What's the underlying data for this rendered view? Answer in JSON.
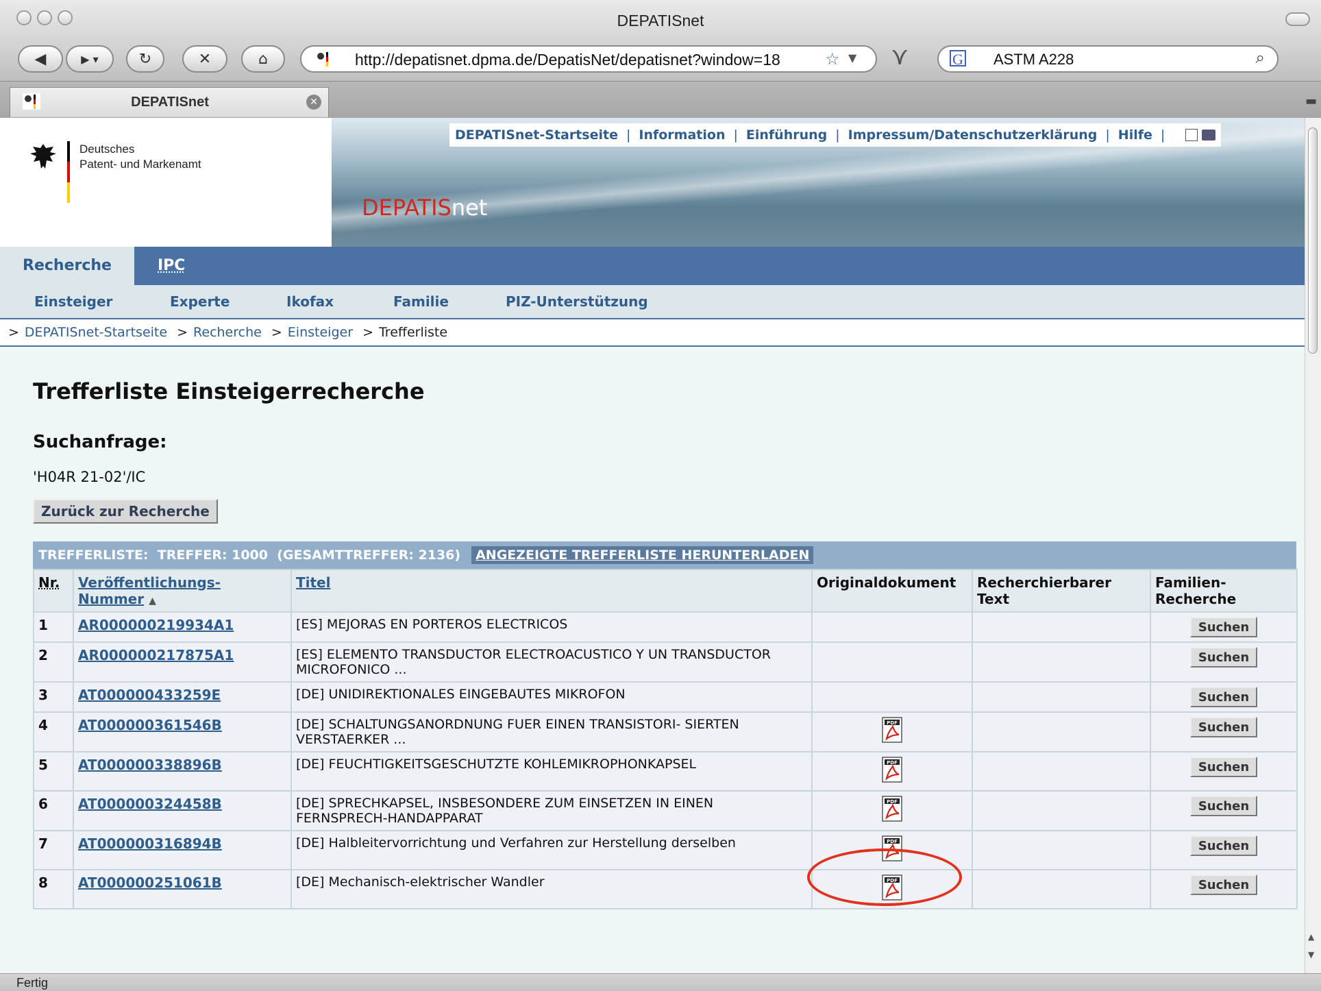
{
  "window": {
    "title": "DEPATISnet"
  },
  "toolbar": {
    "url": "http://depatisnet.dpma.de/DepatisNet/depatisnet?window=18",
    "search_value": "ASTM A228",
    "icons": [
      "back-icon",
      "forward-icon",
      "reload-icon",
      "stop-icon",
      "home-icon",
      "bookmark-star-icon",
      "search-icon"
    ]
  },
  "tab": {
    "title": "DEPATISnet"
  },
  "header": {
    "logo_line1": "Deutsches",
    "logo_line2": "Patent- und Markenamt",
    "brand_part1": "DEPATIS",
    "brand_part2": "net",
    "top_links": [
      "DEPATISnet-Startseite",
      "Information",
      "Einführung",
      "Impressum/Datenschutzerklärung",
      "Hilfe"
    ]
  },
  "nav": {
    "primary": [
      "Recherche",
      "IPC"
    ],
    "secondary": [
      "Einsteiger",
      "Experte",
      "Ikofax",
      "Familie",
      "PIZ-Unterstützung"
    ]
  },
  "breadcrumb": [
    "DEPATISnet-Startseite",
    "Recherche",
    "Einsteiger",
    "Trefferliste"
  ],
  "content": {
    "heading": "Trefferliste Einsteigerrecherche",
    "subheading": "Suchanfrage:",
    "query": "'H04R 21-02'/IC",
    "back_button": "Zurück zur Recherche"
  },
  "results": {
    "summary": "TREFFERLISTE:  TREFFER: 1000  (GESAMTTREFFER: 2136)",
    "download_link": "ANGEZEIGTE TREFFERLISTE HERUNTERLADEN",
    "columns": {
      "nr": "Nr.",
      "number_l1": "Veröffentlichungs-",
      "number_l2": "Nummer",
      "sort_indicator": "▲",
      "title": "Titel",
      "original": "Originaldokument",
      "text_l1": "Recherchierbarer",
      "text_l2": "Text",
      "family_l1": "Familien-",
      "family_l2": "Recherche"
    },
    "search_button": "Suchen",
    "rows": [
      {
        "nr": "1",
        "number": "AR000000219934A1",
        "title": "[ES] MEJORAS EN PORTEROS ELECTRICOS",
        "pdf": false
      },
      {
        "nr": "2",
        "number": "AR000000217875A1",
        "title": "[ES] ELEMENTO TRANSDUCTOR ELECTROACUSTICO Y UN TRANSDUCTOR MICROFONICO ...",
        "pdf": false
      },
      {
        "nr": "3",
        "number": "AT000000433259E",
        "title": "[DE] UNIDIREKTIONALES EINGEBAUTES MIKROFON",
        "pdf": false
      },
      {
        "nr": "4",
        "number": "AT000000361546B",
        "title": "[DE] SCHALTUNGSANORDNUNG FUER EINEN TRANSISTORI- SIERTEN VERSTAERKER ...",
        "pdf": true
      },
      {
        "nr": "5",
        "number": "AT000000338896B",
        "title": "[DE] FEUCHTIGKEITSGESCHUTZTE KOHLEMIKROPHONKAPSEL",
        "pdf": true
      },
      {
        "nr": "6",
        "number": "AT000000324458B",
        "title": "[DE] SPRECHKAPSEL, INSBESONDERE ZUM EINSETZEN IN EINEN FERNSPRECH-HANDAPPARAT",
        "pdf": true
      },
      {
        "nr": "7",
        "number": "AT000000316894B",
        "title": "[DE] Halbleitervorrichtung und Verfahren zur Herstellung derselben",
        "pdf": true
      },
      {
        "nr": "8",
        "number": "AT000000251061B",
        "title": "[DE] Mechanisch-elektrischer Wandler",
        "pdf": true
      }
    ]
  },
  "status": {
    "text": "Fertig"
  },
  "colors": {
    "nav_blue": "#4a72a4",
    "link": "#2f5d8c",
    "brand_red": "#cc2a1c",
    "highlight": "#e0321c"
  }
}
